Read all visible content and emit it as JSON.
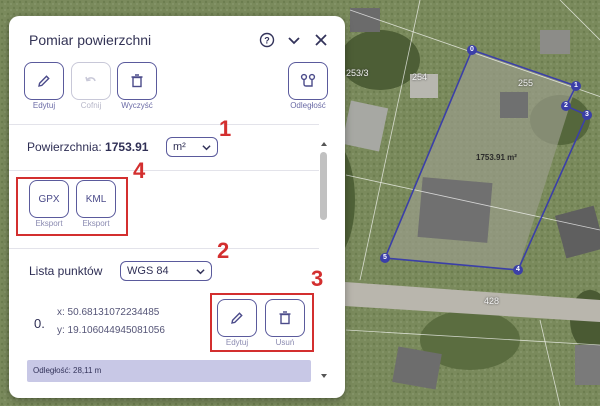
{
  "panel": {
    "title": "Pomiar powierzchni",
    "icons": {
      "help": "question-circle-icon",
      "collapse": "chevron-down-icon",
      "close": "close-icon"
    }
  },
  "toolbar": {
    "edit_label": "Edytuj",
    "undo_label": "Cofnij",
    "clear_label": "Wyczyść",
    "distance_label": "Odległość"
  },
  "area": {
    "label": "Powierzchnia:",
    "value": "1753.91",
    "unit": "m²"
  },
  "export": {
    "gpx_label": "GPX",
    "kml_label": "KML",
    "sub_label": "Eksport"
  },
  "points": {
    "label": "Lista punktów",
    "crs": "WGS 84",
    "items": [
      {
        "index": "0.",
        "x": "x: 50.68131072234485",
        "y": "y: 19.106044945081056"
      }
    ],
    "edit_label": "Edytuj",
    "delete_label": "Usuń"
  },
  "distance_bar": "Odległość: 28,11 m",
  "annotations": [
    "1",
    "2",
    "3",
    "4"
  ],
  "map": {
    "parcels": [
      "253/3",
      "254",
      "255",
      "428"
    ],
    "area_label": "1753.91 m²",
    "vertices": [
      "0",
      "1",
      "2",
      "3",
      "4",
      "5"
    ],
    "polygon_color": "#3b3fa8"
  },
  "colors": {
    "accent": "#5a5a9c",
    "annotation": "#d32f2f",
    "distance_bar": "#c8c8e6"
  }
}
